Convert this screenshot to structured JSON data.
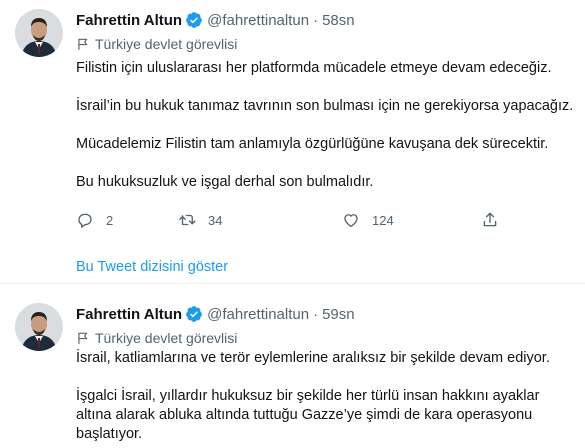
{
  "tweets": [
    {
      "author_name": "Fahrettin Altun",
      "handle": "@fahrettinaltun",
      "separator": "·",
      "time": "58sn",
      "label": "Türkiye devlet görevlisi",
      "paragraphs": [
        "Filistin için uluslararası her platformda mücadele etmeye devam edeceğiz.",
        "İsrail’in bu hukuk tanımaz tavrının son bulması için ne gerekiyorsa yapacağız.",
        "Mücadelemiz Filistin tam anlamıyla özgürlüğüne kavuşana dek sürecektir.",
        "Bu hukuksuzluk ve işgal derhal son bulmalıdır."
      ],
      "replies": "2",
      "retweets": "34",
      "likes": "124"
    },
    {
      "author_name": "Fahrettin Altun",
      "handle": "@fahrettinaltun",
      "separator": "·",
      "time": "59sn",
      "label": "Türkiye devlet görevlisi",
      "paragraphs": [
        "İsrail, katliamlarına ve terör eylemlerine aralıksız bir şekilde devam ediyor.",
        "İşgalci İsrail, yıllardır hukuksuz bir şekilde her türlü insan hakkını ayaklar altına alarak abluka altında tuttuğu Gazze’ye şimdi de kara operasyonu başlatıyor."
      ]
    }
  ],
  "show_thread_label": "Bu Tweet dizisini göster",
  "colors": {
    "accent": "#1d9bf0",
    "secondary_text": "#536471",
    "primary_text": "#0f1419"
  }
}
